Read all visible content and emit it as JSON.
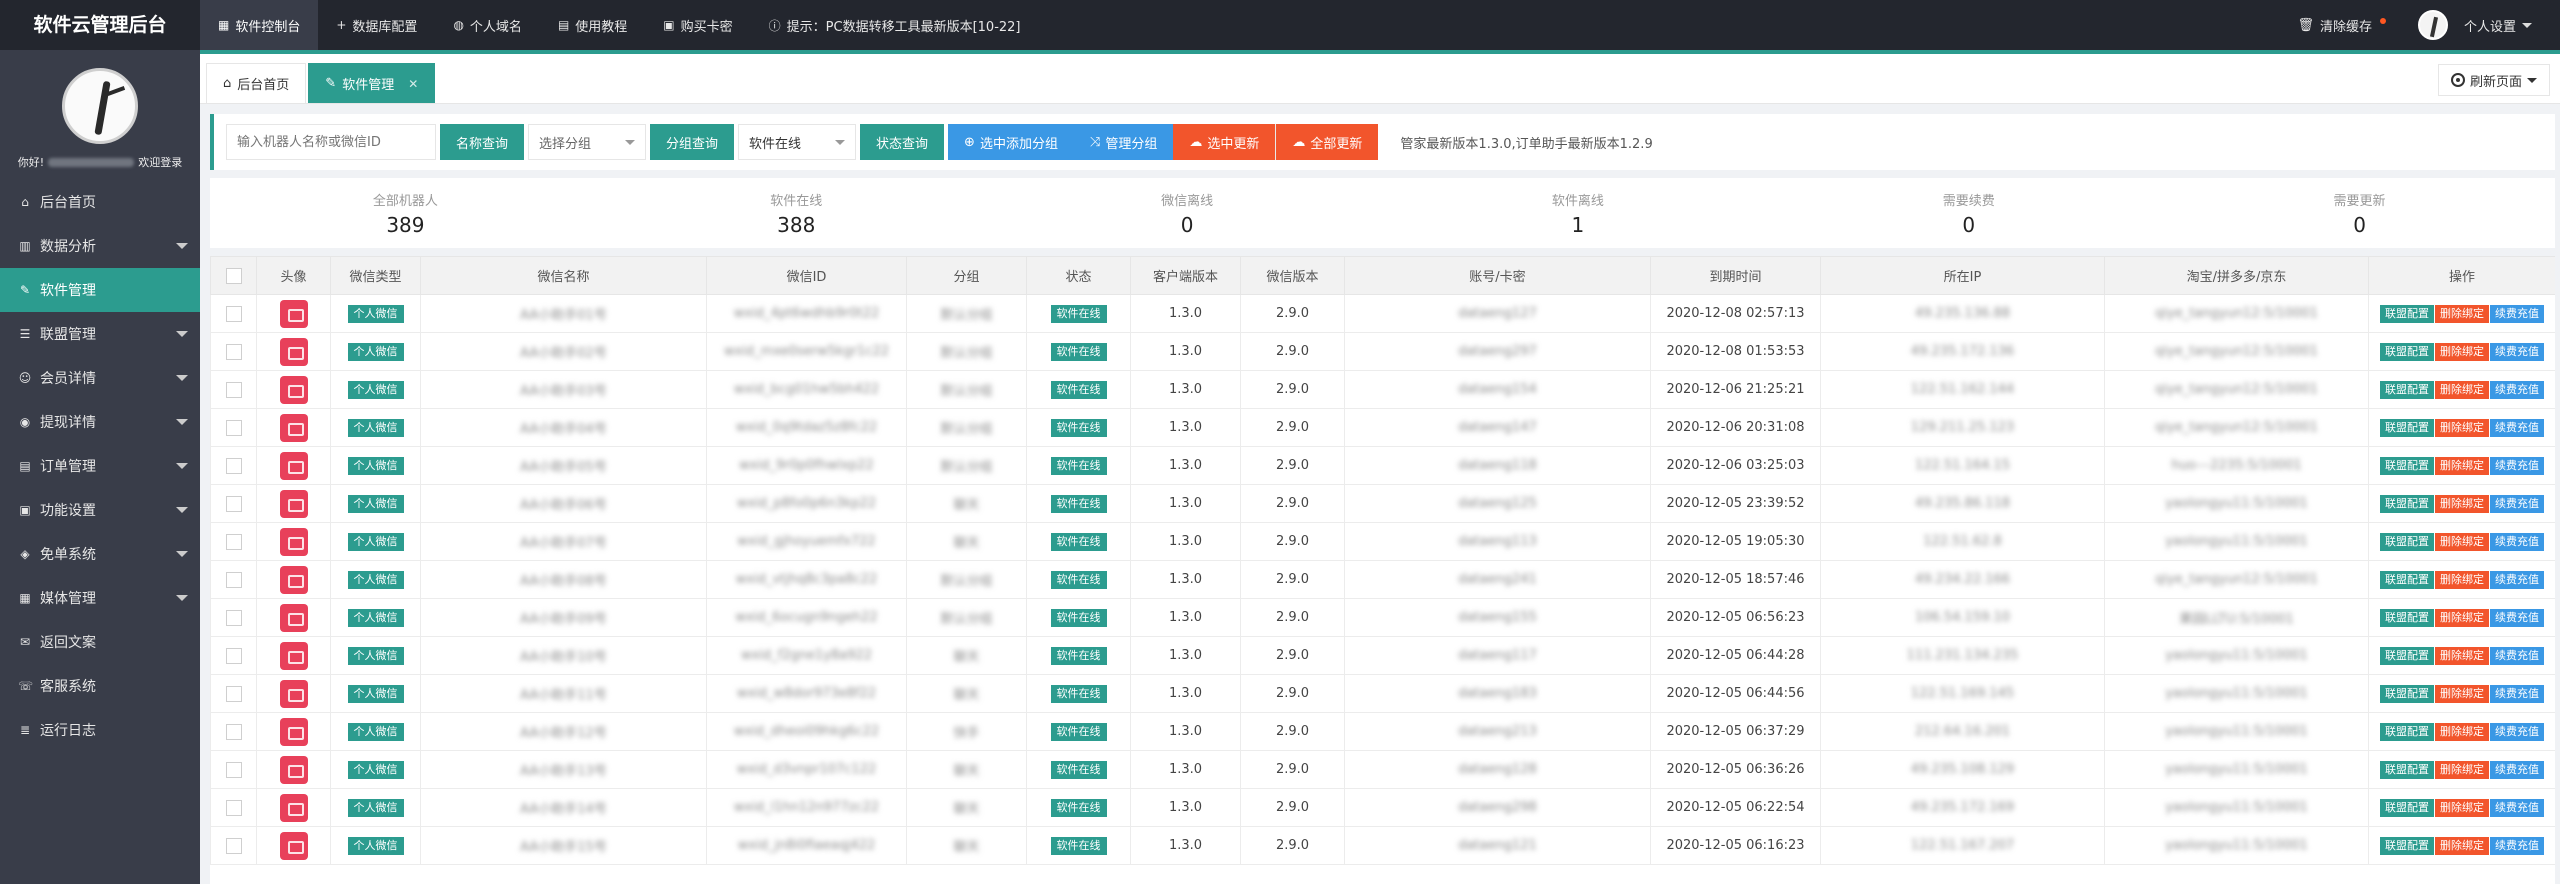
{
  "header": {
    "brand": "软件云管理后台",
    "nav": [
      {
        "label": "软件控制台",
        "icon": "console-icon",
        "active": true
      },
      {
        "label": "数据库配置",
        "icon": "plus-icon",
        "active": false
      },
      {
        "label": "个人域名",
        "icon": "globe-icon",
        "active": false
      },
      {
        "label": "使用教程",
        "icon": "book-icon",
        "active": false
      },
      {
        "label": "购买卡密",
        "icon": "cart-icon",
        "active": false
      },
      {
        "label": "提示：PC数据转移工具最新版本[10-22]",
        "icon": "info-icon",
        "active": false
      }
    ],
    "clear_cache": "清除缓存",
    "personal_settings": "个人设置"
  },
  "sidebar": {
    "greeting_prefix": "你好!",
    "greeting_suffix": "欢迎登录",
    "items": [
      {
        "label": "后台首页",
        "icon": "home-icon",
        "caret": false,
        "active": false
      },
      {
        "label": "数据分析",
        "icon": "chart-icon",
        "caret": true,
        "active": false
      },
      {
        "label": "软件管理",
        "icon": "edit-icon",
        "caret": false,
        "active": true
      },
      {
        "label": "联盟管理",
        "icon": "list-icon",
        "caret": true,
        "active": false
      },
      {
        "label": "会员详情",
        "icon": "user-icon",
        "caret": true,
        "active": false
      },
      {
        "label": "提现详情",
        "icon": "money-icon",
        "caret": true,
        "active": false
      },
      {
        "label": "订单管理",
        "icon": "order-icon",
        "caret": true,
        "active": false
      },
      {
        "label": "功能设置",
        "icon": "settings-icon",
        "caret": true,
        "active": false
      },
      {
        "label": "免单系统",
        "icon": "gift-icon",
        "caret": true,
        "active": false
      },
      {
        "label": "媒体管理",
        "icon": "media-icon",
        "caret": true,
        "active": false
      },
      {
        "label": "返回文案",
        "icon": "chat-icon",
        "caret": false,
        "active": false
      },
      {
        "label": "客服系统",
        "icon": "service-icon",
        "caret": false,
        "active": false
      },
      {
        "label": "运行日志",
        "icon": "log-icon",
        "caret": false,
        "active": false
      }
    ]
  },
  "tabs": {
    "home": "后台首页",
    "current": "软件管理",
    "refresh": "刷新页面"
  },
  "filters": {
    "name_placeholder": "输入机器人名称或微信ID",
    "name_search": "名称查询",
    "group_select": "选择分组",
    "group_search": "分组查询",
    "status_select": "软件在线",
    "status_search": "状态查询",
    "add_group": "选中添加分组",
    "manage_group": "管理分组",
    "update_selected": "选中更新",
    "update_all": "全部更新",
    "notice": "管家最新版本1.3.0,订单助手最新版本1.2.9"
  },
  "stats": [
    {
      "label": "全部机器人",
      "value": "389"
    },
    {
      "label": "软件在线",
      "value": "388"
    },
    {
      "label": "微信离线",
      "value": "0"
    },
    {
      "label": "软件离线",
      "value": "1"
    },
    {
      "label": "需要续费",
      "value": "0"
    },
    {
      "label": "需要更新",
      "value": "0"
    }
  ],
  "table": {
    "headers": [
      "",
      "头像",
      "微信类型",
      "微信名称",
      "微信ID",
      "分组",
      "状态",
      "客户端版本",
      "微信版本",
      "账号/卡密",
      "到期时间",
      "所在IP",
      "淘宝/拼多多/京东",
      "操作"
    ],
    "op_labels": {
      "config": "联盟配置",
      "unbind": "删除绑定",
      "renew": "续费充值"
    },
    "rows": [
      {
        "type": "个人微信",
        "name": "AA小助手01号",
        "wxid": "wxid_4pt6wdhb9r0t22",
        "group": "默认分组",
        "status": "软件在线",
        "client": "1.3.0",
        "wechat": "2.9.0",
        "account": "dataeng127",
        "expire": "2020-12-08 02:57:13",
        "ip": "49.235.136.88",
        "shop": "qiye_tangyun12:5/10001",
        "ops": true
      },
      {
        "type": "个人微信",
        "name": "AA小助手02号",
        "wxid": "wxid_mxe0serw5kgr1c22",
        "group": "默认分组",
        "status": "软件在线",
        "client": "1.3.0",
        "wechat": "2.9.0",
        "account": "dataeng297",
        "expire": "2020-12-08 01:53:53",
        "ip": "49.235.172.136",
        "shop": "qiye_tangyun12:5/10001",
        "ops": true
      },
      {
        "type": "个人微信",
        "name": "AA小助手03号",
        "wxid": "wxid_bcg01hw5bh422",
        "group": "默认分组",
        "status": "软件在线",
        "client": "1.3.0",
        "wechat": "2.9.0",
        "account": "dataeng154",
        "expire": "2020-12-06 21:25:21",
        "ip": "122.51.162.144",
        "shop": "qiye_tangyun12:5/10001",
        "ops": true
      },
      {
        "type": "个人微信",
        "name": "AA小助手04号",
        "wxid": "wxid_0q9tdaz5z8fc22",
        "group": "默认分组",
        "status": "软件在线",
        "client": "1.3.0",
        "wechat": "2.9.0",
        "account": "dataeng147",
        "expire": "2020-12-06 20:31:08",
        "ip": "129.211.25.123",
        "shop": "qiye_tangyun12:5/10001",
        "ops": true
      },
      {
        "type": "个人微信",
        "name": "AA小助手05号",
        "wxid": "wxid_9r0p0fhwlxp22",
        "group": "默认分组",
        "status": "软件在线",
        "client": "1.3.0",
        "wechat": "2.9.0",
        "account": "dataeng118",
        "expire": "2020-12-06 03:25:03",
        "ip": "122.51.164.15",
        "shop": "huo---2235:5/10001",
        "ops": true
      },
      {
        "type": "个人微信",
        "name": "AA小助手06号",
        "wxid": "wxid_p8fo0p6n3kp22",
        "group": "聊天",
        "status": "软件在线",
        "client": "1.3.0",
        "wechat": "2.9.0",
        "account": "dataeng125",
        "expire": "2020-12-05 23:39:52",
        "ip": "49.235.86.118",
        "shop": "yaolongyu11:5/10001",
        "ops": true
      },
      {
        "type": "个人微信",
        "name": "AA小助手07号",
        "wxid": "wxid_gjhoyuemfx722",
        "group": "聊天",
        "status": "软件在线",
        "client": "1.3.0",
        "wechat": "2.9.0",
        "account": "dataeng113",
        "expire": "2020-12-05 19:05:30",
        "ip": "122.51.62.8",
        "shop": "yaolongyu11:5/10001",
        "ops": true
      },
      {
        "type": "个人微信",
        "name": "AA小助手08号",
        "wxid": "wxid_vtjhq8c3pa8c22",
        "group": "默认分组",
        "status": "软件在线",
        "client": "1.3.0",
        "wechat": "2.9.0",
        "account": "dataeng241",
        "expire": "2020-12-05 18:57:46",
        "ip": "49.234.22.166",
        "shop": "qiye_tangyun12:5/10001",
        "ops": true
      },
      {
        "type": "个人微信",
        "name": "AA小助手09号",
        "wxid": "wxid_6ocugn9ngeh22",
        "group": "默认分组",
        "status": "软件在线",
        "client": "1.3.0",
        "wechat": "2.9.0",
        "account": "dataeng155",
        "expire": "2020-12-05 06:56:23",
        "ip": "106.54.159.10",
        "shop": "果园LLTU:5/10001",
        "ops": true
      },
      {
        "type": "个人微信",
        "name": "AA小助手10号",
        "wxid": "wxid_f2gne1y8a922",
        "group": "聊天",
        "status": "软件在线",
        "client": "1.3.0",
        "wechat": "2.9.0",
        "account": "dataeng117",
        "expire": "2020-12-05 06:44:28",
        "ip": "111.231.134.235",
        "shop": "yaolongyu11:5/10001",
        "ops": true
      },
      {
        "type": "个人微信",
        "name": "AA小助手11号",
        "wxid": "wxid_w8dor973e8f22",
        "group": "聊天",
        "status": "软件在线",
        "client": "1.3.0",
        "wechat": "2.9.0",
        "account": "dataeng183",
        "expire": "2020-12-05 06:44:56",
        "ip": "122.51.169.145",
        "shop": "yaolongyu11:5/10001",
        "ops": true
      },
      {
        "type": "个人微信",
        "name": "AA小助手12号",
        "wxid": "wxid_dheoi09hkg6c22",
        "group": "快手",
        "status": "软件在线",
        "client": "1.3.0",
        "wechat": "2.9.0",
        "account": "dataeng213",
        "expire": "2020-12-05 06:37:29",
        "ip": "212.64.16.201",
        "shop": "yaolongyu11:5/10001",
        "ops": true
      },
      {
        "type": "个人微信",
        "name": "AA小助手13号",
        "wxid": "wxid_d3vnpr107c122",
        "group": "聊天",
        "status": "软件在线",
        "client": "1.3.0",
        "wechat": "2.9.0",
        "account": "dataeng128",
        "expire": "2020-12-05 06:36:26",
        "ip": "49.235.108.129",
        "shop": "yaolongyu11:5/10001",
        "ops": true
      },
      {
        "type": "个人微信",
        "name": "AA小助手14号",
        "wxid": "wxid_l1hn12n977zc22",
        "group": "聊天",
        "status": "软件在线",
        "client": "1.3.0",
        "wechat": "2.9.0",
        "account": "dataeng298",
        "expire": "2020-12-05 06:22:54",
        "ip": "49.235.172.169",
        "shop": "yaolongyu11:5/10001",
        "ops": true
      },
      {
        "type": "个人微信",
        "name": "AA小助手15号",
        "wxid": "wxid_jn8i0fiaeaqj422",
        "group": "聊天",
        "status": "软件在线",
        "client": "1.3.0",
        "wechat": "2.9.0",
        "account": "dataeng121",
        "expire": "2020-12-05 06:16:23",
        "ip": "122.51.167.207",
        "shop": "yaolongyu11:5/10001",
        "ops": true
      }
    ]
  },
  "colors": {
    "primary": "#2c9c8f",
    "blue": "#3a98e5",
    "red": "#f2552c",
    "dark": "#23262e",
    "sidebar": "#393d49"
  }
}
